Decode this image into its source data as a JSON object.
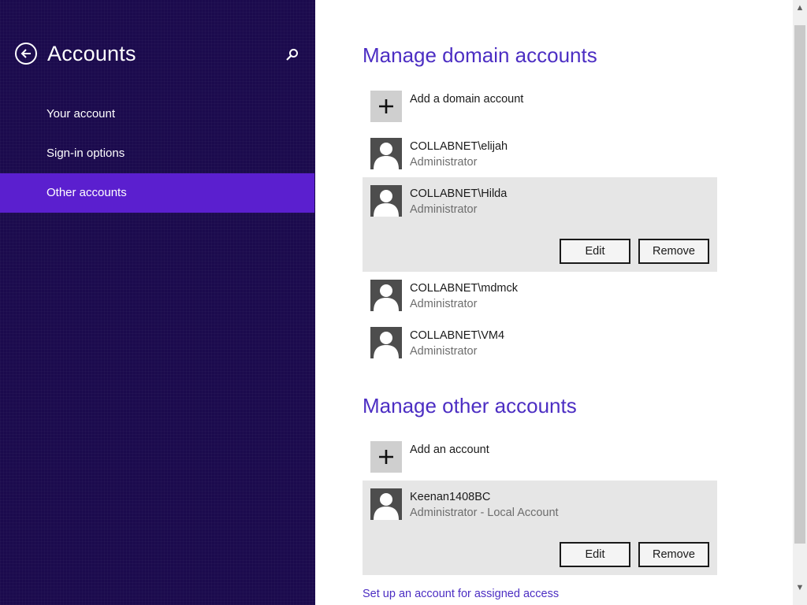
{
  "sidebar": {
    "title": "Accounts",
    "items": [
      {
        "label": "Your account"
      },
      {
        "label": "Sign-in options"
      },
      {
        "label": "Other accounts"
      }
    ]
  },
  "domain": {
    "title": "Manage domain accounts",
    "add_label": "Add a domain account",
    "accounts": [
      {
        "name": "COLLABNET\\elijah",
        "role": "Administrator"
      },
      {
        "name": "COLLABNET\\Hilda",
        "role": "Administrator"
      },
      {
        "name": "COLLABNET\\mdmck",
        "role": "Administrator"
      },
      {
        "name": "COLLABNET\\VM4",
        "role": "Administrator"
      }
    ]
  },
  "other": {
    "title": "Manage other accounts",
    "add_label": "Add an account",
    "accounts": [
      {
        "name": "Keenan1408BC",
        "role": "Administrator - Local Account"
      }
    ]
  },
  "buttons": {
    "edit": "Edit",
    "remove": "Remove"
  },
  "assigned_access_link": "Set up an account for assigned access",
  "colors": {
    "sidebar_bg": "#1b0a4d",
    "sidebar_active": "#5b1fcf",
    "accent": "#4c2ec3",
    "selected_row": "#e6e6e6"
  },
  "icons": {
    "back": "back-arrow-icon",
    "search": "search-icon",
    "add": "plus-icon",
    "avatar": "user-avatar-icon"
  }
}
